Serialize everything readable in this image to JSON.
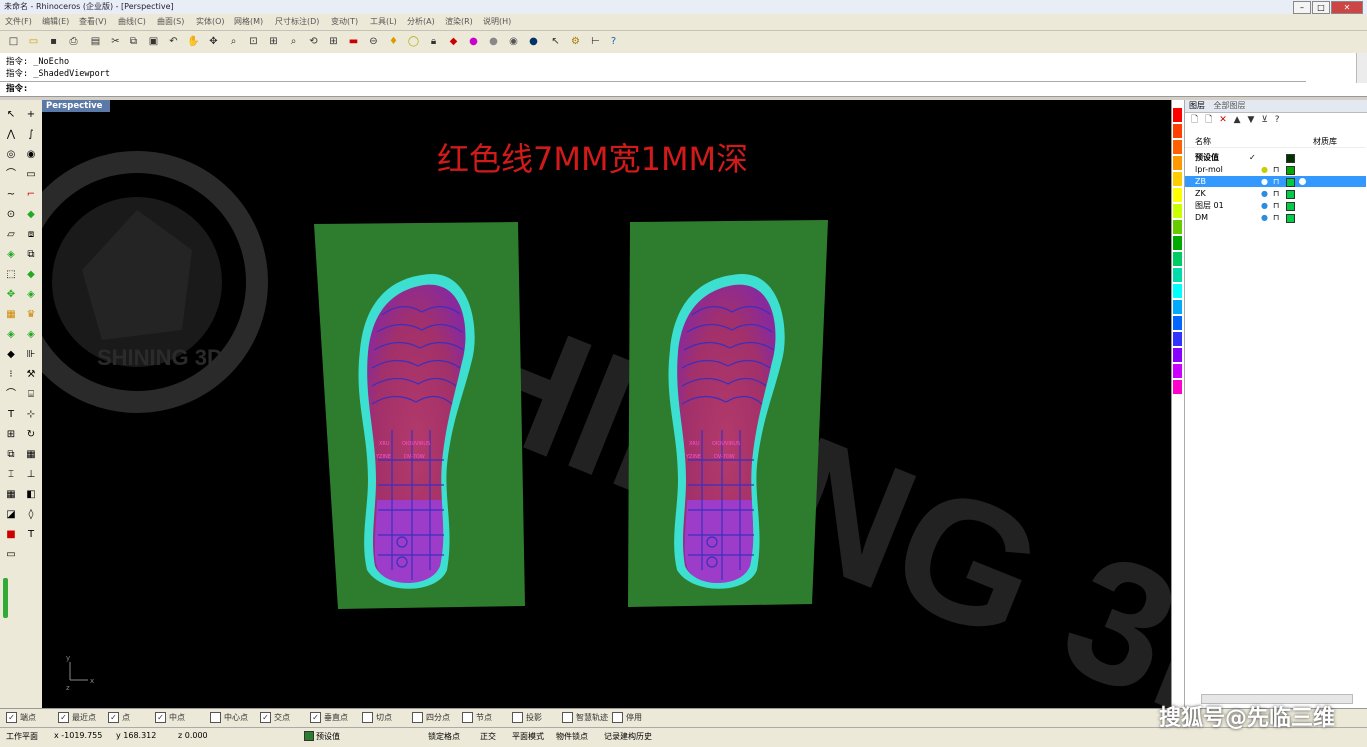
{
  "window": {
    "title": "未命名 - Rhinoceros (企业版) - [Perspective]"
  },
  "menu": [
    "文件(F)",
    "编辑(E)",
    "查看(V)",
    "曲线(C)",
    "曲面(S)",
    "实体(O)",
    "网格(M)",
    "尺寸标注(D)",
    "变动(T)",
    "工具(L)",
    "分析(A)",
    "渲染(R)",
    "说明(H)"
  ],
  "command": {
    "history": [
      {
        "prompt": "指令:",
        "text": "_NoEcho"
      },
      {
        "prompt": "指令:",
        "text": "_ShadedViewport"
      }
    ],
    "input_prompt": "指令:"
  },
  "viewport": {
    "tab_label": "Perspective",
    "annotation": "红色线7MM宽1MM深",
    "background_watermark": "SHINING 3D",
    "logo_ring_text": "SHINING 3D",
    "sole_labels": [
      "XRU",
      "OIOUVIRUS",
      "YZINE",
      "DV-7OW"
    ],
    "axis_labels": {
      "y": "y",
      "x": "x",
      "z": "z"
    }
  },
  "layers": {
    "tabs": [
      "图层",
      "全部图层"
    ],
    "columns": {
      "name": "名称",
      "material": "材质库"
    },
    "rows": [
      {
        "name": "预设值",
        "check": "✓",
        "color": "#003300",
        "selected": false
      },
      {
        "name": "lpr-mol",
        "check": "",
        "color": "#00aa00",
        "selected": false
      },
      {
        "name": "ZB",
        "check": "",
        "color": "#00cc44",
        "selected": true
      },
      {
        "name": "ZK",
        "check": "",
        "color": "#00cc44",
        "selected": false
      },
      {
        "name": "图层 01",
        "check": "",
        "color": "#00cc44",
        "selected": false
      },
      {
        "name": "DM",
        "check": "",
        "color": "#00cc44",
        "selected": false
      }
    ]
  },
  "snaps": [
    {
      "label": "端点",
      "checked": true
    },
    {
      "label": "最近点",
      "checked": true
    },
    {
      "label": "点",
      "checked": true
    },
    {
      "label": "中点",
      "checked": true
    },
    {
      "label": "中心点",
      "checked": false
    },
    {
      "label": "交点",
      "checked": true
    },
    {
      "label": "垂直点",
      "checked": true
    },
    {
      "label": "切点",
      "checked": false
    },
    {
      "label": "四分点",
      "checked": false
    },
    {
      "label": "节点",
      "checked": false
    },
    {
      "label": "投影",
      "checked": false
    },
    {
      "label": "智慧轨迹",
      "checked": false
    },
    {
      "label": "停用",
      "checked": false
    }
  ],
  "status": {
    "cplane": "工作平面",
    "x": "x -1019.755",
    "y": "y 168.312",
    "z": "z 0.000",
    "layer": "预设值",
    "toggles": [
      "锁定格点",
      "正交",
      "平面模式",
      "物件锁点",
      "记录建构历史"
    ]
  },
  "watermark": "搜狐号@先临三维",
  "colors": {
    "viewport_bg": "#000000",
    "plate": "#2e7d2e",
    "sole_red": "#b33a6a",
    "sole_purple": "#9c3cc8",
    "sole_cyan": "#3de0d0",
    "annotation": "#d11a1a",
    "selected_row": "#3399ff"
  }
}
